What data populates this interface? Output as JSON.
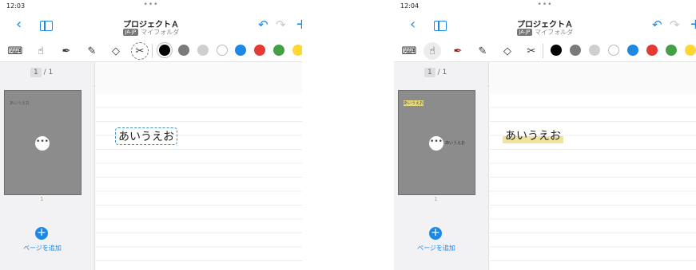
{
  "left": {
    "status": {
      "time": "12:03",
      "menu_dots": "•••"
    },
    "nav": {
      "back": "‹",
      "title": "プロジェクトＡ",
      "lang_badge": "JA-JP",
      "folder": "マイフォルダ",
      "undo": "↶",
      "redo": "↷",
      "add": "+"
    },
    "toolbar": {
      "keyboard": "⌨",
      "hand": "☝",
      "pen": "✒",
      "highlighter": "✎",
      "eraser": "◇",
      "lasso": "✂"
    },
    "sidebar": {
      "page_current": "1",
      "page_total": "/ 1",
      "thumb_text": "あいうえお",
      "thumb_more": "•••",
      "thumb_num": "1",
      "add_icon": "+",
      "add_label": "ページを追加"
    },
    "canvas": {
      "handwriting": "あいうえお"
    }
  },
  "right": {
    "status": {
      "time": "12:04",
      "menu_dots": "•••"
    },
    "nav": {
      "back": "‹",
      "title": "プロジェクトＡ",
      "lang_badge": "JA-JP",
      "folder": "マイフォルダ",
      "undo": "↶",
      "redo": "↷",
      "add": "+"
    },
    "toolbar": {
      "keyboard": "⌨",
      "hand": "☝",
      "pen": "✒",
      "highlighter": "✎",
      "eraser": "◇",
      "lasso": "✂"
    },
    "sidebar": {
      "page_current": "1",
      "page_total": "/ 1",
      "thumb_text": "あいうえお",
      "thumb_more": "•••",
      "thumb_more_label": "あいうえお",
      "thumb_num": "1",
      "add_icon": "+",
      "add_label": "ページを追加"
    },
    "canvas": {
      "handwriting": "あいうえお"
    }
  },
  "colors": {
    "accent": "#1e88e5",
    "swatches": [
      "#000000",
      "#7a7a7a",
      "#cfcfcf",
      "#ffffff",
      "#1e88e5",
      "#e53935",
      "#43a047",
      "#fdd835"
    ]
  }
}
